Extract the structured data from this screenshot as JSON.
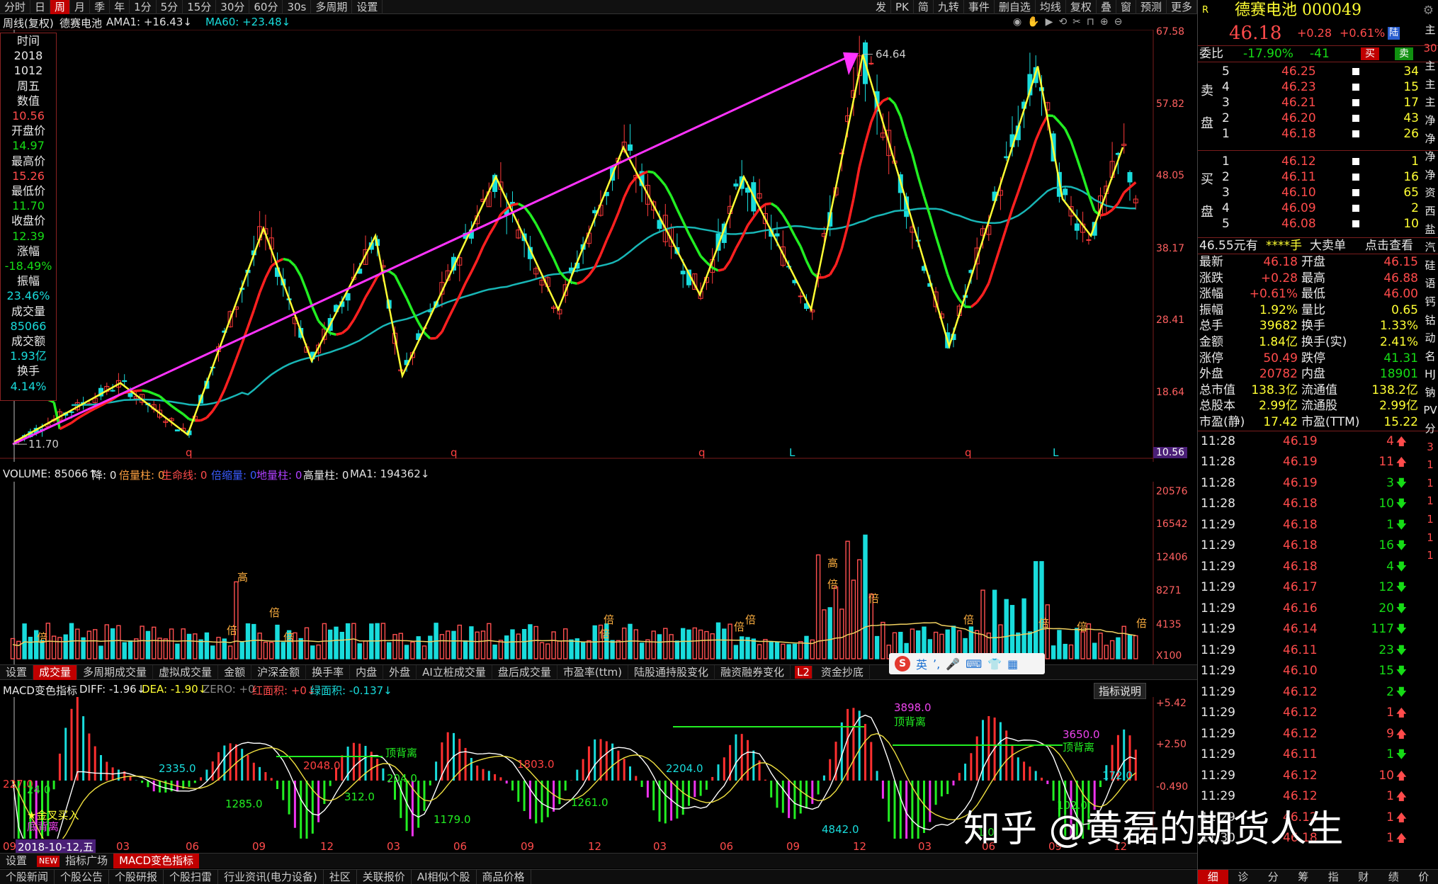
{
  "top_tabs": [
    "分时",
    "日",
    "周",
    "月",
    "季",
    "年",
    "1分",
    "5分",
    "15分",
    "30分",
    "60分",
    "30s",
    "多周期",
    "设置"
  ],
  "top_tab_active_index": 2,
  "top_right_tabs": [
    "发",
    "PK",
    "简",
    "九转",
    "事件",
    "删自选",
    "均线",
    "复权",
    "叠",
    "窗",
    "预测",
    "更多"
  ],
  "legend": {
    "period": "周线(复权)",
    "stock": "德赛电池",
    "ama1": "AMA1: +16.43↓",
    "ma60": "MA60: +23.48↓"
  },
  "info_box": [
    {
      "t": "时间",
      "c": "wht"
    },
    {
      "t": "2018",
      "c": "wht"
    },
    {
      "t": "1012",
      "c": "wht"
    },
    {
      "t": "周五",
      "c": "wht"
    },
    {
      "t": "数值",
      "c": "wht"
    },
    {
      "t": "10.56",
      "c": "red"
    },
    {
      "t": "开盘价",
      "c": "wht"
    },
    {
      "t": "14.97",
      "c": "green"
    },
    {
      "t": "最高价",
      "c": "wht"
    },
    {
      "t": "15.26",
      "c": "red"
    },
    {
      "t": "最低价",
      "c": "wht"
    },
    {
      "t": "11.70",
      "c": "green"
    },
    {
      "t": "收盘价",
      "c": "wht"
    },
    {
      "t": "12.39",
      "c": "green"
    },
    {
      "t": "涨幅",
      "c": "wht"
    },
    {
      "t": "-18.49%",
      "c": "green"
    },
    {
      "t": "振幅",
      "c": "wht"
    },
    {
      "t": "23.46%",
      "c": "cyan"
    },
    {
      "t": "成交量",
      "c": "wht"
    },
    {
      "t": "85066",
      "c": "cyan"
    },
    {
      "t": "成交额",
      "c": "wht"
    },
    {
      "t": "1.93亿",
      "c": "cyan"
    },
    {
      "t": "换手",
      "c": "wht"
    },
    {
      "t": "4.14%",
      "c": "cyan"
    }
  ],
  "price_axis": [
    "67.58",
    "57.82",
    "48.05",
    "38.17",
    "28.41",
    "18.64"
  ],
  "price_axis_current": "10.56",
  "price_high_label": "64.64",
  "price_low_label": "11.70",
  "signal_marks": [
    "q",
    "q",
    "q",
    "L",
    "q",
    "L"
  ],
  "volume_legend": {
    "vol": "VOLUME: 85066↑",
    "jiang": "降: 0",
    "beiliang": "倍量柱: 0",
    "shengming": "生命线: 0",
    "beisuo": "倍缩量: 0",
    "diliang": "地量柱: 0",
    "gaoliang": "高量柱: 0",
    "ma1": "MA1: 194362↓"
  },
  "volume_axis": [
    "20576",
    "16542",
    "12406",
    "8271",
    "4135"
  ],
  "volume_unit": "X100",
  "volume_marks": {
    "gao": "高",
    "bei": "倍"
  },
  "indicator_tabs": [
    "设置",
    "成交量",
    "多周期成交量",
    "虚拟成交量",
    "金额",
    "沪深金额",
    "换手率",
    "内盘",
    "外盘",
    "AI立桩成交量",
    "盘后成交量",
    "市盈率(ttm)",
    "陆股通持股变化",
    "融资融券变化",
    "L2",
    "资金抄底"
  ],
  "indicator_tab_active_index": 1,
  "macd_legend": {
    "name": "MACD变色指标",
    "diff": "DIFF: -1.96↓",
    "dea": "DEA: -1.90↓",
    "zero": "ZERO: +0",
    "hong": "红面积: +0↓",
    "lv": "绿面积: -0.137↓"
  },
  "macd_help": "指标说明",
  "macd_axis": [
    "+5.42",
    "+2.50",
    "-0.490"
  ],
  "macd_labels": [
    "227.0",
    "24.0",
    "2335.0",
    "1285.0",
    "2048.0",
    "312.0",
    "顶背离",
    "204.0",
    "1179.0",
    "1803.0",
    "1261.0",
    "2204.0",
    "3898.0",
    "顶背离",
    "4842.0",
    "3650.0",
    "顶背离",
    "102.0",
    "172.0",
    "1.0"
  ],
  "macd_buy": "★金叉买入",
  "macd_div": "底背离",
  "time_axis": {
    "first": "09",
    "cursor": "2018-10-12,五",
    "ticks": [
      "03",
      "06",
      "09",
      "12",
      "03",
      "06",
      "09",
      "12",
      "03",
      "06",
      "09",
      "12",
      "03",
      "06",
      "09",
      "12"
    ]
  },
  "bottom_tabs": [
    "设置",
    "NEW",
    "指标广场",
    "MACD变色指标"
  ],
  "bottom_news": [
    "个股新闻",
    "个股公告",
    "个股研报",
    "个股扫雷",
    "行业资讯(电力设备)",
    "社区",
    "关联报价",
    "AI相似个股",
    "商品价格"
  ],
  "ime": {
    "s": "S",
    "txt": "英"
  },
  "watermark": "知乎 @黄磊的期货人生",
  "right_panel": {
    "flag": "R",
    "name": "德赛电池 000049",
    "price": "46.18",
    "change": "+0.28",
    "pct": "+0.61%",
    "lu": "陆",
    "weibi": {
      "label": "委比",
      "pct": "-17.90%",
      "diff": "-41",
      "buy": "买",
      "sell": "卖"
    },
    "sell_label": "卖盘",
    "buy_label": "买盘",
    "asks": [
      [
        "5",
        "46.25",
        "34"
      ],
      [
        "4",
        "46.23",
        "15"
      ],
      [
        "3",
        "46.21",
        "17"
      ],
      [
        "2",
        "46.20",
        "43"
      ],
      [
        "1",
        "46.18",
        "26"
      ]
    ],
    "bids": [
      [
        "1",
        "46.12",
        "1"
      ],
      [
        "2",
        "46.11",
        "16"
      ],
      [
        "3",
        "46.10",
        "65"
      ],
      [
        "4",
        "46.09",
        "2"
      ],
      [
        "5",
        "46.08",
        "10"
      ]
    ],
    "promo": {
      "a": "46.55元有",
      "b": "****手",
      "c": "大卖单",
      "d": "点击查看"
    },
    "stats": [
      [
        "最新",
        "46.18",
        "开盘",
        "46.15"
      ],
      [
        "涨跌",
        "+0.28",
        "最高",
        "46.88"
      ],
      [
        "涨幅",
        "+0.61%",
        "最低",
        "46.00"
      ],
      [
        "振幅",
        "1.92%",
        "量比",
        "0.65"
      ],
      [
        "总手",
        "39682",
        "换手",
        "1.33%"
      ],
      [
        "金额",
        "1.84亿",
        "换手(实)",
        "2.41%"
      ],
      [
        "涨停",
        "50.49",
        "跌停",
        "41.31"
      ],
      [
        "外盘",
        "20782",
        "内盘",
        "18901"
      ],
      [
        "总市值",
        "138.3亿",
        "流通值",
        "138.2亿"
      ],
      [
        "总股本",
        "2.99亿",
        "流通股",
        "2.99亿"
      ],
      [
        "市盈(静)",
        "17.42",
        "市盈(TTM)",
        "15.22"
      ]
    ],
    "trades": [
      [
        "11:28",
        "46.19",
        "4",
        "up"
      ],
      [
        "11:28",
        "46.19",
        "11",
        "up"
      ],
      [
        "11:28",
        "46.19",
        "3",
        "dn"
      ],
      [
        "11:28",
        "46.18",
        "10",
        "dn"
      ],
      [
        "11:29",
        "46.18",
        "1",
        "dn"
      ],
      [
        "11:29",
        "46.18",
        "16",
        "dn"
      ],
      [
        "11:29",
        "46.18",
        "4",
        "dn"
      ],
      [
        "11:29",
        "46.17",
        "12",
        "dn"
      ],
      [
        "11:29",
        "46.16",
        "20",
        "dn"
      ],
      [
        "11:29",
        "46.14",
        "117",
        "dn"
      ],
      [
        "11:29",
        "46.11",
        "23",
        "dn"
      ],
      [
        "11:29",
        "46.10",
        "15",
        "dn"
      ],
      [
        "11:29",
        "46.12",
        "2",
        "dn"
      ],
      [
        "11:29",
        "46.12",
        "1",
        "up"
      ],
      [
        "11:29",
        "46.12",
        "9",
        "up"
      ],
      [
        "11:29",
        "46.11",
        "1",
        "dn"
      ],
      [
        "11:29",
        "46.12",
        "10",
        "up"
      ],
      [
        "11:29",
        "46.12",
        "1",
        "up"
      ],
      [
        "11:29",
        "46.12",
        "1",
        "up"
      ],
      [
        "11:30",
        "46.18",
        "1",
        "up"
      ]
    ],
    "right_edge": [
      "主",
      "30",
      "主",
      "主",
      "主",
      "净",
      "净",
      "净",
      "净",
      "资",
      "西",
      "盐",
      "汽",
      "硅",
      "语",
      "钙",
      "钴",
      "动",
      "名",
      "HJ",
      "钠",
      "PV",
      "分",
      "3",
      "1",
      "1",
      "1",
      "1",
      "1",
      "1"
    ],
    "bottom_tabs": [
      "细",
      "诊",
      "分",
      "筹",
      "指",
      "财",
      "绩",
      "价"
    ]
  }
}
